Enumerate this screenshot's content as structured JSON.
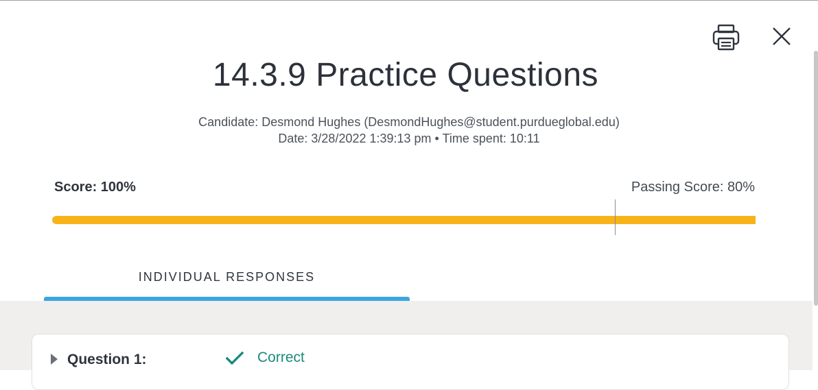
{
  "header": {
    "title": "14.3.9 Practice Questions",
    "candidate_line": "Candidate: Desmond Hughes  (DesmondHughes@student.purdueglobal.edu)",
    "date_line": "Date: 3/28/2022 1:39:13 pm • Time spent: 10:11",
    "print_icon": "printer-icon",
    "close_icon": "close-icon"
  },
  "score": {
    "label": "Score: 100%",
    "passing_label": "Passing Score: 80%",
    "score_fraction": 1.0,
    "passing_fraction": 0.8,
    "bar_color": "#f8b318"
  },
  "tabs": [
    {
      "label": "INDIVIDUAL RESPONSES",
      "active": true
    }
  ],
  "accent_color": "#3aa6e0",
  "questions": [
    {
      "label": "Question 1:",
      "status": "Correct",
      "status_icon": "checkmark-icon",
      "status_color": "#1a8a7c"
    }
  ]
}
